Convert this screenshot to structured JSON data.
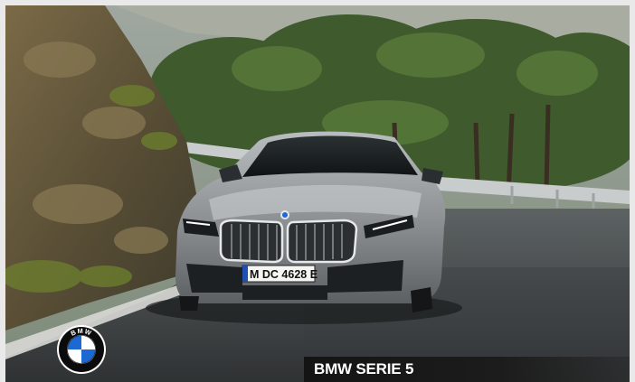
{
  "photo": {
    "subject": "BMW 5 Series sedan driving on a mountain road",
    "license_plate": "M DC 4628 E"
  },
  "logo": {
    "name": "bmw-roundel",
    "letters": "BMW",
    "colors": {
      "ring": "#0b0b0b",
      "blue": "#1c69d4",
      "white": "#ffffff",
      "outline": "#ffffff"
    }
  },
  "caption": {
    "title": "BMW SERIE 5"
  }
}
